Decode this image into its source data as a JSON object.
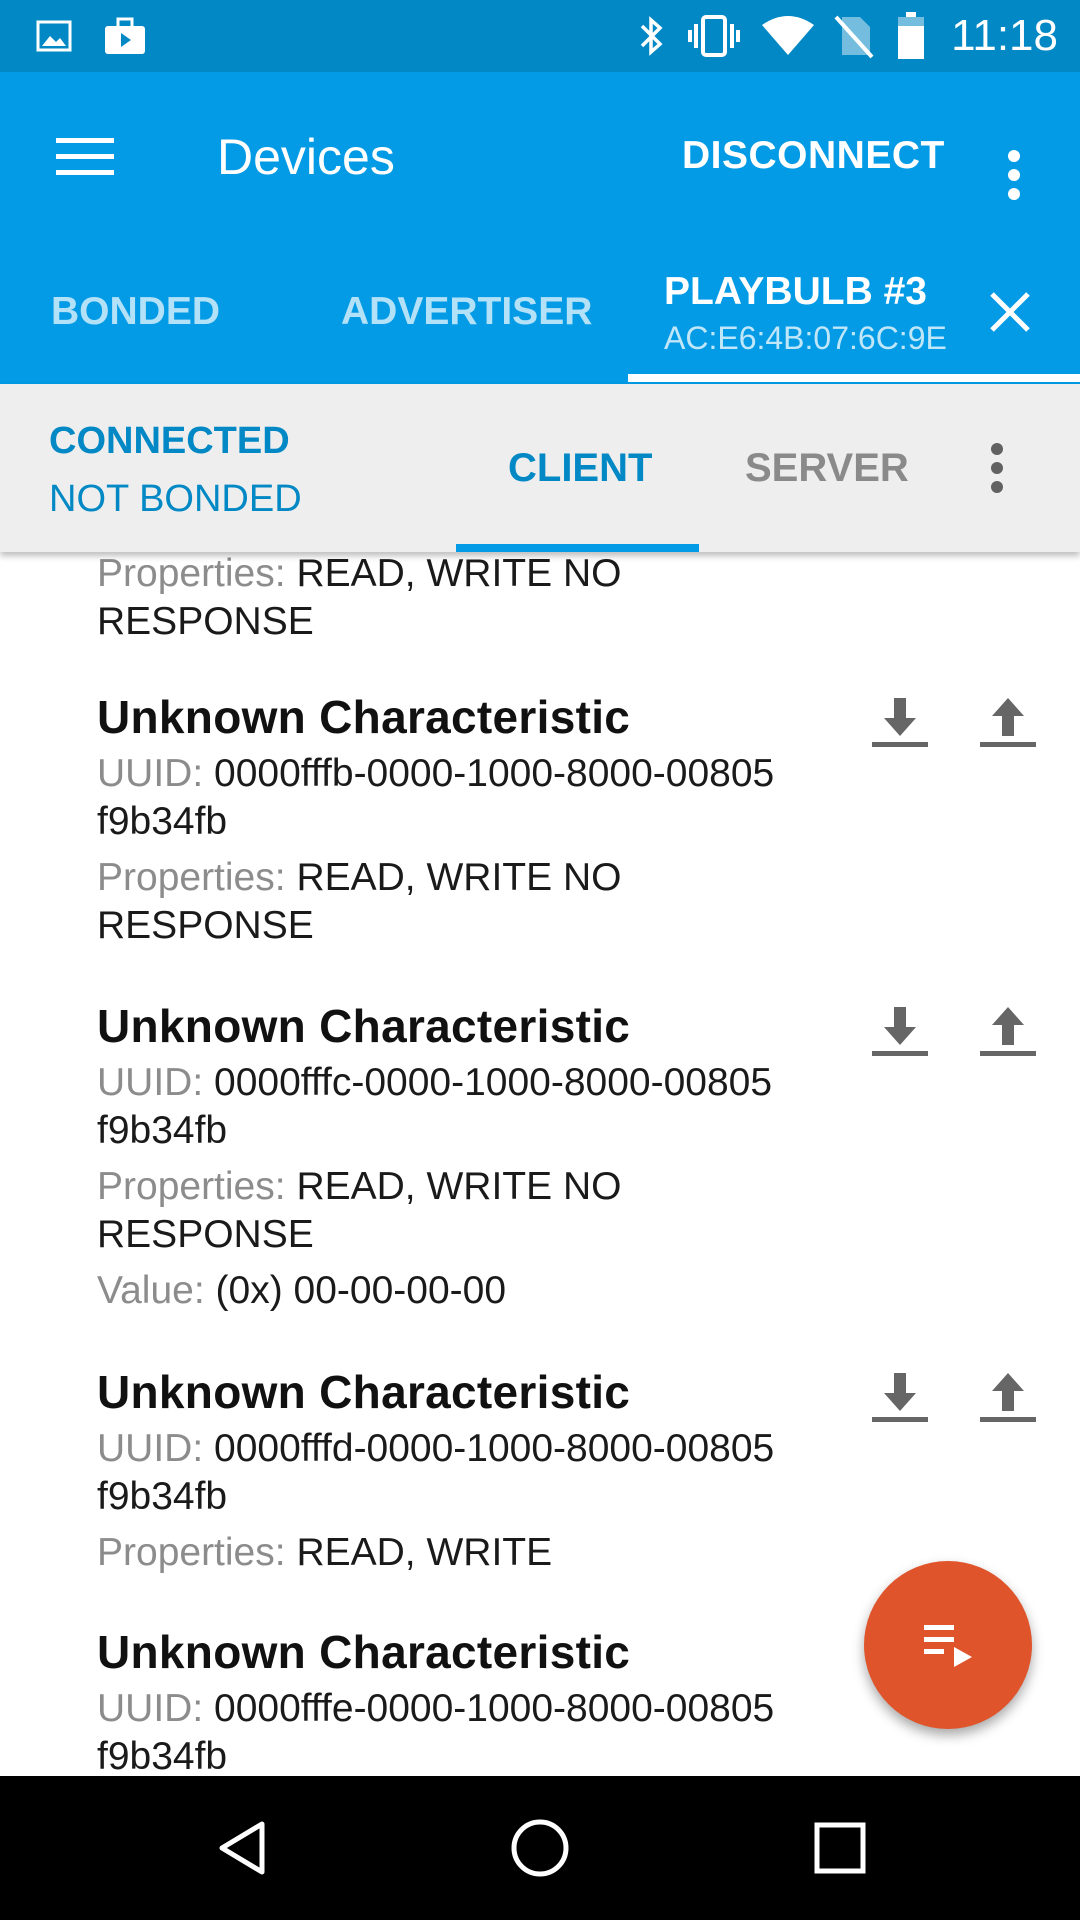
{
  "status_bar": {
    "time": "11:18",
    "icons": [
      "gallery-icon",
      "briefcase-play-icon",
      "bluetooth-icon",
      "vibrate-icon",
      "wifi-icon",
      "no-sim-icon",
      "battery-icon"
    ]
  },
  "app_bar": {
    "title": "Devices",
    "disconnect_label": "DISCONNECT",
    "tabs": {
      "bonded": "BONDED",
      "advertiser": "ADVERTISER",
      "device_name": "PLAYBULB #3",
      "device_mac": "AC:E6:4B:07:6C:9E"
    }
  },
  "sub_bar": {
    "connection_state": "CONNECTED",
    "bond_state": "NOT BONDED",
    "tab_client": "CLIENT",
    "tab_server": "SERVER"
  },
  "characteristics": {
    "labels": {
      "uuid": "UUID:",
      "properties": "Properties:",
      "value": "Value:"
    },
    "partial_top": {
      "properties_line1": "READ, WRITE NO",
      "properties_line2": "RESPONSE"
    },
    "items": [
      {
        "title": "Unknown Characteristic",
        "uuid_line1": "0000fffb-0000-1000-8000-00805",
        "uuid_line2": "f9b34fb",
        "properties_line1": "READ, WRITE NO",
        "properties_line2": "RESPONSE"
      },
      {
        "title": "Unknown Characteristic",
        "uuid_line1": "0000fffc-0000-1000-8000-00805",
        "uuid_line2": "f9b34fb",
        "properties_line1": "READ, WRITE NO",
        "properties_line2": "RESPONSE",
        "value": "(0x) 00-00-00-00"
      },
      {
        "title": "Unknown Characteristic",
        "uuid_line1": "0000fffd-0000-1000-8000-00805",
        "uuid_line2": "f9b34fb",
        "properties_line1": "READ, WRITE"
      },
      {
        "title": "Unknown Characteristic",
        "uuid_line1": "0000fffe-0000-1000-8000-00805",
        "uuid_line2": "f9b34fb"
      }
    ]
  },
  "colors": {
    "status_bar": "#0288c4",
    "app_bar": "#039be5",
    "accent": "#0288c4",
    "fab": "#e0542b"
  },
  "fab_icon": "playlist-play-icon",
  "nav": [
    "back-icon",
    "home-icon",
    "recents-icon"
  ]
}
